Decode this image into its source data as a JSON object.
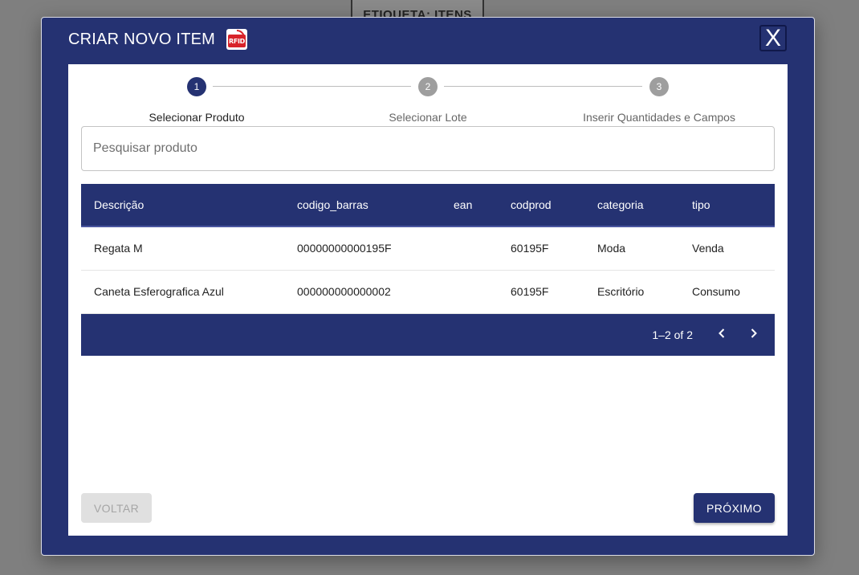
{
  "background": {
    "tab_label": "ETIQUETA: ITENS"
  },
  "modal": {
    "title": "CRIAR NOVO ITEM",
    "rfid_icon_text": "RFID",
    "close_label": "X"
  },
  "stepper": {
    "steps": [
      {
        "number": "1",
        "label": "Selecionar Produto",
        "active": true
      },
      {
        "number": "2",
        "label": "Selecionar Lote",
        "active": false
      },
      {
        "number": "3",
        "label": "Inserir Quantidades e Campos",
        "active": false
      }
    ]
  },
  "search": {
    "placeholder": "Pesquisar produto",
    "value": ""
  },
  "table": {
    "columns": [
      "Descrição",
      "codigo_barras",
      "ean",
      "codprod",
      "categoria",
      "tipo"
    ],
    "rows": [
      [
        "Regata M",
        "00000000000195F",
        "",
        "60195F",
        "Moda",
        "Venda"
      ],
      [
        "Caneta Esferografica Azul",
        "000000000000002",
        "",
        "60195F",
        "Escritório",
        "Consumo"
      ]
    ]
  },
  "pagination": {
    "range_label": "1–2 of 2",
    "prev_icon": "chevron-left-icon",
    "next_icon": "chevron-right-icon"
  },
  "footer": {
    "back_label": "VOLTAR",
    "next_label": "PRÓXIMO"
  },
  "colors": {
    "primary": "#253272",
    "step_inactive": "#9e9e9e",
    "overlay": "#7f7f7f"
  }
}
